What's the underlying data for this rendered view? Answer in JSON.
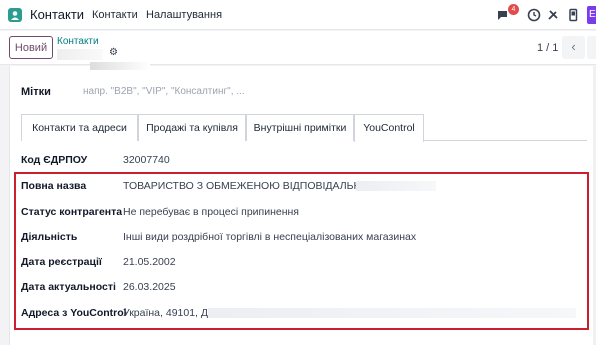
{
  "navbar": {
    "app_name": "Контакти",
    "links": [
      "Контакти",
      "Налаштування"
    ],
    "messages_badge": "4",
    "user_initial": "E"
  },
  "control": {
    "new_button": "Новий",
    "breadcrumb_parent": "Контакти",
    "pager": "1 / 1"
  },
  "form": {
    "tags_label": "Мітки",
    "tags_placeholder": "напр. \"B2B\", \"VIP\", \"Консалтинг\", ...",
    "tabs": [
      "Контакти та адреси",
      "Продажі та купівля",
      "Внутрішні примітки",
      "YouControl"
    ],
    "fields": [
      {
        "label": "Код ЄДРПОУ",
        "value": "32007740"
      },
      {
        "label": "Повна назва",
        "value": "ТОВАРИСТВО З ОБМЕЖЕНОЮ ВІДПОВІДАЛЬНІСТЮ"
      },
      {
        "label": "Статус контрагента",
        "value": "Не перебуває в процесі припинення"
      },
      {
        "label": "Діяльність",
        "value": "Інші види роздрібної торгівлі в неспеціалізованих магазинах"
      },
      {
        "label": "Дата реєстрації",
        "value": "21.05.2002"
      },
      {
        "label": "Дата актуальності",
        "value": "26.03.2025"
      },
      {
        "label": "Адреса з YouControl",
        "value": "Україна, 49101, Д"
      }
    ]
  },
  "colors": {
    "accent": "#714b67",
    "highlight": "#c8202f",
    "link": "#017e84"
  }
}
